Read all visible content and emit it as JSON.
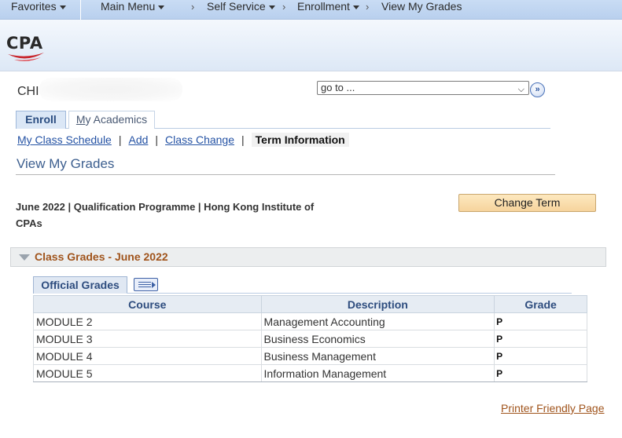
{
  "topnav": {
    "favorites": "Favorites",
    "main_menu": "Main Menu",
    "self_service": "Self Service",
    "enrollment": "Enrollment",
    "view_my_grades": "View My Grades"
  },
  "logo": {
    "text": "CPA",
    "colors": {
      "text": "#2a2a2a",
      "swoosh": "#c8252c"
    }
  },
  "user": {
    "name_visible": "CHI"
  },
  "goto": {
    "value": "go to ..."
  },
  "tabs": [
    {
      "label_first": "M",
      "label_rest": "y Academics",
      "enroll": "Enroll"
    }
  ],
  "tab_enroll": "Enroll",
  "tab_academics": {
    "underlined": "M",
    "rest": "y Academics"
  },
  "subnav": {
    "my_class_schedule_u": "M",
    "my_class_schedule_rest": "y Class Schedule",
    "add_u": "A",
    "add_rest": "dd",
    "class_change_u": "C",
    "class_change_rest": "lass Change",
    "term_information": "Term Information"
  },
  "page_title": "View My Grades",
  "term_info": "June 2022 | Qualification Programme | Hong Kong Institute of CPAs",
  "change_term_label": "Change Term",
  "section_title": "Class Grades - June 2022",
  "grid_tab_label": "Official Grades",
  "table": {
    "headers": [
      "Course",
      "Description",
      "Grade"
    ],
    "rows": [
      {
        "course": "MODULE 2",
        "description": "Management Accounting",
        "grade": "P"
      },
      {
        "course": "MODULE 3",
        "description": "Business Economics",
        "grade": "P"
      },
      {
        "course": "MODULE 4",
        "description": "Business Management",
        "grade": "P"
      },
      {
        "course": "MODULE 5",
        "description": "Information Management",
        "grade": "P"
      }
    ]
  },
  "printer_friendly_label": "Printer Friendly Page",
  "colors": {
    "accent_link": "#2452a4",
    "section_title": "#a0541c",
    "button_bg": "#f6d49d"
  }
}
